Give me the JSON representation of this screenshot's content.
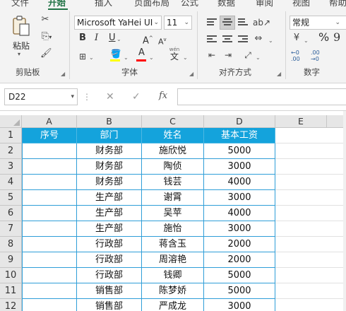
{
  "menu": {
    "tabs": [
      "文件",
      "开始",
      "插入",
      "页面布局",
      "公式",
      "数据",
      "审阅",
      "视图",
      "帮助"
    ],
    "active_index": 1
  },
  "ribbon": {
    "clipboard": {
      "paste_label": "粘贴",
      "group_label": "剪贴板"
    },
    "font": {
      "font_name": "Microsoft YaHei UI",
      "font_size": "11",
      "bold": "B",
      "italic": "I",
      "underline": "U",
      "grow": "A",
      "shrink": "A",
      "font_color_letter": "A",
      "wen": "wén",
      "wen_char": "文",
      "group_label": "字体",
      "fill_color": "#ffff00",
      "font_color": "#ff0000"
    },
    "alignment": {
      "group_label": "对齐方式"
    },
    "number": {
      "format": "常规",
      "percent": "%",
      "comma": "9",
      "dec_inc": "←0 .00",
      "dec_dec": ".00 →0",
      "group_label": "数字"
    }
  },
  "formula_bar": {
    "name_box": "D22",
    "fx": "fx",
    "cancel": "✕",
    "enter": "✓",
    "formula": ""
  },
  "sheet": {
    "columns": [
      "A",
      "B",
      "C",
      "D",
      "E"
    ],
    "row_numbers": [
      "1",
      "2",
      "3",
      "4",
      "5",
      "6",
      "7",
      "8",
      "9",
      "10",
      "11",
      "12"
    ],
    "header_fill": "#14a3dc",
    "header": [
      "序号",
      "部门",
      "姓名",
      "基本工资"
    ],
    "rows": [
      [
        "",
        "财务部",
        "施欣悦",
        "5000"
      ],
      [
        "",
        "财务部",
        "陶侦",
        "3000"
      ],
      [
        "",
        "财务部",
        "钱芸",
        "4000"
      ],
      [
        "",
        "生产部",
        "谢霄",
        "3000"
      ],
      [
        "",
        "生产部",
        "吴苹",
        "4000"
      ],
      [
        "",
        "生产部",
        "施怡",
        "3000"
      ],
      [
        "",
        "行政部",
        "蒋含玉",
        "2000"
      ],
      [
        "",
        "行政部",
        "周溶艳",
        "2000"
      ],
      [
        "",
        "行政部",
        "钱卿",
        "5000"
      ],
      [
        "",
        "销售部",
        "陈梦娇",
        "5000"
      ],
      [
        "",
        "销售部",
        "严成龙",
        "3000"
      ]
    ]
  }
}
